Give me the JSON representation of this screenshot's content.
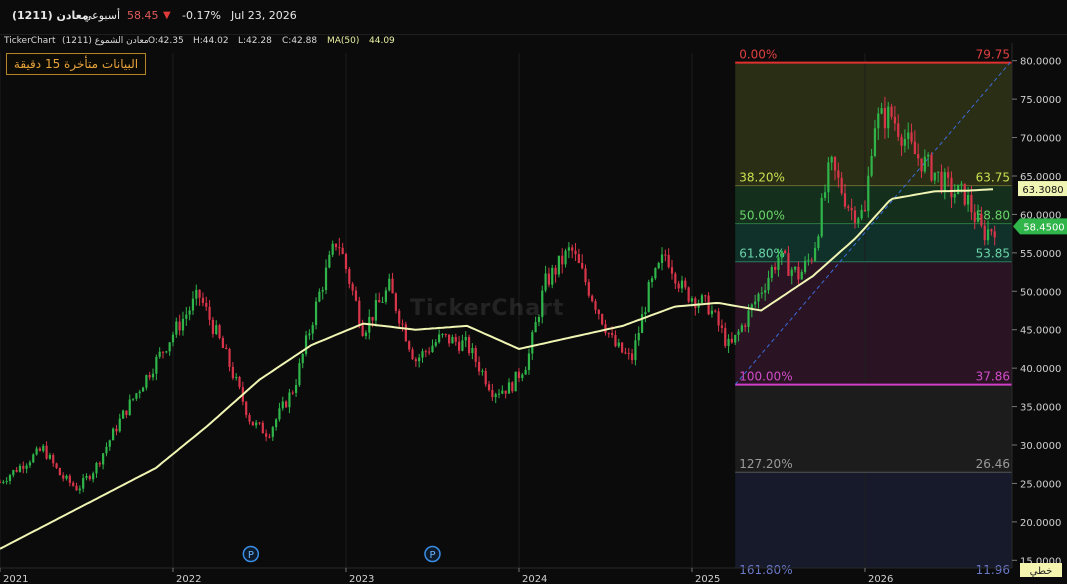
{
  "topbar": {
    "symbol": "(1211) معادن",
    "interval": "أسبوعي",
    "price": "58.45",
    "change_pct": "-0.17%",
    "date": "Jul 23, 2026"
  },
  "infobar": {
    "brand": "TickerChart",
    "series_name": "(1211) معادن الشموع",
    "open": "O:42.35",
    "high": "H:44.02",
    "low": "L:42.28",
    "close": "C:42.88",
    "ma_label": "MA(50)",
    "ma_value": "44.09"
  },
  "delay_badge": "البيانات متأخرة 15 دقيقة",
  "watermark": "TickerChart",
  "scale_button": "خطي",
  "colors": {
    "up": "#2fb54a",
    "down": "#d9354a",
    "ma": "#f0f5b4",
    "fib_0": "#e03030",
    "fib_100": "#d23fc8",
    "accent_price": "#8ee08e"
  },
  "chart_data": {
    "type": "candlestick",
    "x_ticks": [
      "2021",
      "2022",
      "2023",
      "2024",
      "2025",
      "2026"
    ],
    "y_ticks": [
      "80.0000",
      "75.0000",
      "70.0000",
      "65.0000",
      "60.0000",
      "55.0000",
      "50.0000",
      "45.0000",
      "40.0000",
      "35.0000",
      "30.0000",
      "25.0000",
      "20.0000",
      "15.0000"
    ],
    "ylim": [
      14,
      81
    ],
    "x_range": [
      2021.0,
      2026.85
    ],
    "last_price": "58.4500",
    "ma_last": "63.3080",
    "ma_period": 50,
    "price_path": [
      [
        2021.0,
        25.2
      ],
      [
        2021.15,
        27.8
      ],
      [
        2021.25,
        29.5
      ],
      [
        2021.35,
        26.0
      ],
      [
        2021.45,
        24.3
      ],
      [
        2021.55,
        27.0
      ],
      [
        2021.7,
        33.5
      ],
      [
        2021.85,
        39.0
      ],
      [
        2022.0,
        44.5
      ],
      [
        2022.15,
        49.5
      ],
      [
        2022.3,
        42.0
      ],
      [
        2022.45,
        33.0
      ],
      [
        2022.55,
        31.5
      ],
      [
        2022.7,
        37.5
      ],
      [
        2022.85,
        50.0
      ],
      [
        2022.95,
        57.0
      ],
      [
        2023.1,
        45.0
      ],
      [
        2023.25,
        50.5
      ],
      [
        2023.4,
        41.0
      ],
      [
        2023.55,
        44.0
      ],
      [
        2023.7,
        43.0
      ],
      [
        2023.85,
        37.0
      ],
      [
        2023.95,
        37.5
      ],
      [
        2024.05,
        41.0
      ],
      [
        2024.15,
        51.0
      ],
      [
        2024.3,
        55.5
      ],
      [
        2024.45,
        48.0
      ],
      [
        2024.55,
        43.0
      ],
      [
        2024.65,
        41.0
      ],
      [
        2024.75,
        50.0
      ],
      [
        2024.85,
        55.0
      ],
      [
        2024.95,
        50.0
      ],
      [
        2025.1,
        48.0
      ],
      [
        2025.22,
        42.5
      ],
      [
        2025.35,
        48.0
      ],
      [
        2025.5,
        54.5
      ],
      [
        2025.62,
        52.0
      ],
      [
        2025.7,
        55.0
      ],
      [
        2025.8,
        66.5
      ],
      [
        2025.92,
        60.5
      ],
      [
        2026.0,
        60.0
      ],
      [
        2026.05,
        72.0
      ],
      [
        2026.15,
        73.0
      ],
      [
        2026.28,
        68.0
      ],
      [
        2026.4,
        65.5
      ],
      [
        2026.5,
        63.0
      ],
      [
        2026.58,
        62.5
      ],
      [
        2026.68,
        57.5
      ],
      [
        2026.75,
        58.45
      ]
    ],
    "ma_path": [
      [
        2021.0,
        16.5
      ],
      [
        2021.3,
        20.0
      ],
      [
        2021.6,
        23.5
      ],
      [
        2021.9,
        27.0
      ],
      [
        2022.2,
        32.5
      ],
      [
        2022.5,
        38.5
      ],
      [
        2022.8,
        43.0
      ],
      [
        2023.1,
        45.8
      ],
      [
        2023.4,
        45.0
      ],
      [
        2023.7,
        45.5
      ],
      [
        2024.0,
        42.5
      ],
      [
        2024.3,
        44.0
      ],
      [
        2024.6,
        45.5
      ],
      [
        2024.9,
        48.0
      ],
      [
        2025.15,
        48.5
      ],
      [
        2025.4,
        47.5
      ],
      [
        2025.7,
        52.0
      ],
      [
        2025.95,
        57.0
      ],
      [
        2026.15,
        62.0
      ],
      [
        2026.4,
        63.0
      ],
      [
        2026.6,
        63.1
      ],
      [
        2026.75,
        63.3
      ]
    ],
    "fibonacci": {
      "x_start": 2025.25,
      "x_end": 2026.85,
      "levels": [
        {
          "pct": "0.00%",
          "value": "79.75",
          "price": 79.75
        },
        {
          "pct": "38.20%",
          "value": "63.75",
          "price": 63.75
        },
        {
          "pct": "50.00%",
          "value": "58.80",
          "price": 58.8
        },
        {
          "pct": "61.80%",
          "value": "53.85",
          "price": 53.85
        },
        {
          "pct": "100.00%",
          "value": "37.86",
          "price": 37.86
        },
        {
          "pct": "127.20%",
          "value": "26.46",
          "price": 26.46
        },
        {
          "pct": "161.80%",
          "value": "11.96",
          "price": 11.96
        }
      ]
    },
    "dividend_markers": [
      {
        "x": 2022.45,
        "label": "P"
      },
      {
        "x": 2023.5,
        "label": "P"
      }
    ]
  }
}
